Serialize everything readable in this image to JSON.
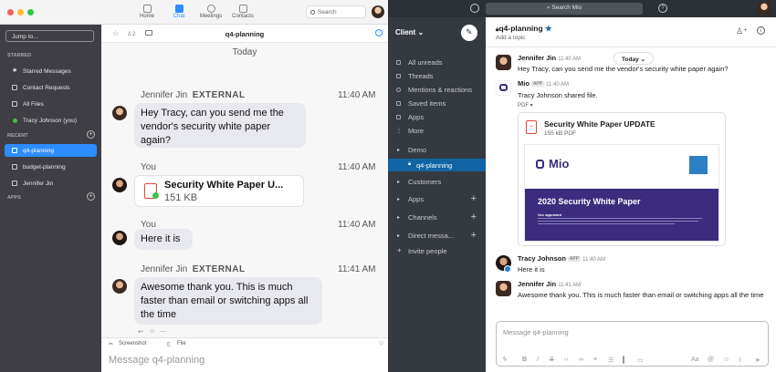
{
  "zoom": {
    "nav": [
      {
        "label": "Home"
      },
      {
        "label": "Chat"
      },
      {
        "label": "Meetings"
      },
      {
        "label": "Contacts"
      }
    ],
    "search_label": "Search",
    "jump_label": "Jump to...",
    "sections": {
      "starred": "STARRED",
      "recent": "RECENT",
      "apps": "APPS"
    },
    "starred_items": [
      "Starred Messages",
      "Contact Requests",
      "All Files",
      "Tracy Johnson  (you)"
    ],
    "recent_items": [
      "q4-planning",
      "budget-planning",
      "Jennifer Jin"
    ],
    "channel_title": "q4-planning",
    "member_count": "2",
    "today_label": "Today",
    "messages": [
      {
        "sender": "Jennifer Jin",
        "tag": "EXTERNAL",
        "time": "11:40 AM",
        "text": "Hey Tracy, can you send me the vendor's security white paper again?"
      },
      {
        "sender": "You",
        "time": "11:40 AM",
        "file_name": "Security White Paper U...",
        "file_size": "151 KB"
      },
      {
        "sender": "You",
        "time": "11:40 AM",
        "text": "Here it is"
      },
      {
        "sender": "Jennifer Jin",
        "tag": "EXTERNAL",
        "time": "11:41 AM",
        "text": "Awesome thank you. This is much faster than email or switching apps all the time"
      }
    ],
    "composer": {
      "screenshot_label": "Screenshot",
      "file_label": "File",
      "placeholder": "Message q4-planning"
    },
    "colors": {
      "accent": "#2d8cff",
      "sidebar": "#3e3e44"
    }
  },
  "slack": {
    "search_label": "Search Mio",
    "workspace": "Client",
    "nav_items": [
      "All unreads",
      "Threads",
      "Mentions & reactions",
      "Saved items",
      "Apps",
      "More"
    ],
    "channels": [
      "Demo",
      "q4-planning",
      "Customers"
    ],
    "groups": [
      "Apps",
      "Channels",
      "Direct messa..."
    ],
    "invite_label": "Invite people",
    "channel_title": "q4-planning",
    "topic_label": "Add a topic",
    "today_label": "Today",
    "messages": [
      {
        "sender": "Jennifer Jin",
        "time": "11:40 AM",
        "text": "Hey Tracy, can you send me the vendor's security white paper again?"
      },
      {
        "sender": "Mio",
        "app": "APP",
        "time": "11:40 AM",
        "text": "Tracy Johnson shared file.",
        "file_type": "PDF",
        "file_title": "Security White Paper UPDATE",
        "file_meta": "155 kB PDF",
        "preview_brand": "Mio",
        "preview_title": "2020 Security White Paper",
        "preview_sub": "Our approach"
      },
      {
        "sender": "Tracy Johnson",
        "app": "APP",
        "time": "11:40 AM",
        "text": "Here it is"
      },
      {
        "sender": "Jennifer Jin",
        "time": "11:41 AM",
        "text": "Awesome thank you. This is much faster than email or switching apps all the time"
      }
    ],
    "composer_placeholder": "Message q4-planning",
    "colors": {
      "sidebar": "#353a40",
      "active": "#1164a3",
      "topbar": "#2c3137",
      "mio_purple": "#3b2c7e",
      "pdf_red": "#e0443b"
    }
  }
}
